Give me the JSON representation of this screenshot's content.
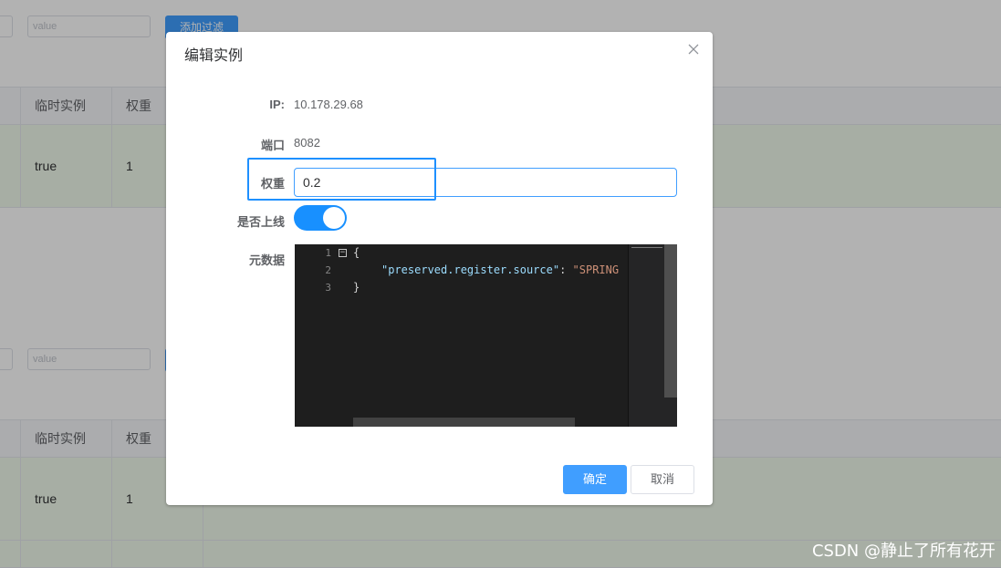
{
  "background": {
    "filter_top": {
      "key_placeholder": "",
      "value_placeholder": "value",
      "add_filter_label": "添加过滤"
    },
    "filter_bottom": {
      "key_placeholder": "",
      "value_placeholder": "value"
    },
    "table_top": {
      "headers": [
        "临时实例",
        "权重"
      ],
      "row": [
        "true",
        "1"
      ]
    },
    "table_bottom": {
      "headers": [
        "临时实例",
        "权重"
      ],
      "row": [
        "true",
        "1"
      ]
    }
  },
  "dialog": {
    "title": "编辑实例",
    "fields": {
      "ip_label": "IP:",
      "ip_value": "10.178.29.68",
      "port_label": "端口",
      "port_value": "8082",
      "weight_label": "权重",
      "weight_value": "0.2",
      "online_label": "是否上线",
      "online_state": true,
      "metadata_label": "元数据"
    },
    "editor": {
      "line_numbers": [
        "1",
        "2",
        "3"
      ],
      "line1": "{",
      "line2_key": "\"preserved.register.source\"",
      "line2_sep": ": ",
      "line2_value": "\"SPRING",
      "line3": "}"
    },
    "confirm_label": "确定",
    "cancel_label": "取消"
  },
  "watermark": "CSDN @静止了所有花开",
  "colors": {
    "primary": "#409eff",
    "switch_on": "#1890ff",
    "row_highlight": "#f0f9eb",
    "annotation_box": "#1e90ff"
  }
}
